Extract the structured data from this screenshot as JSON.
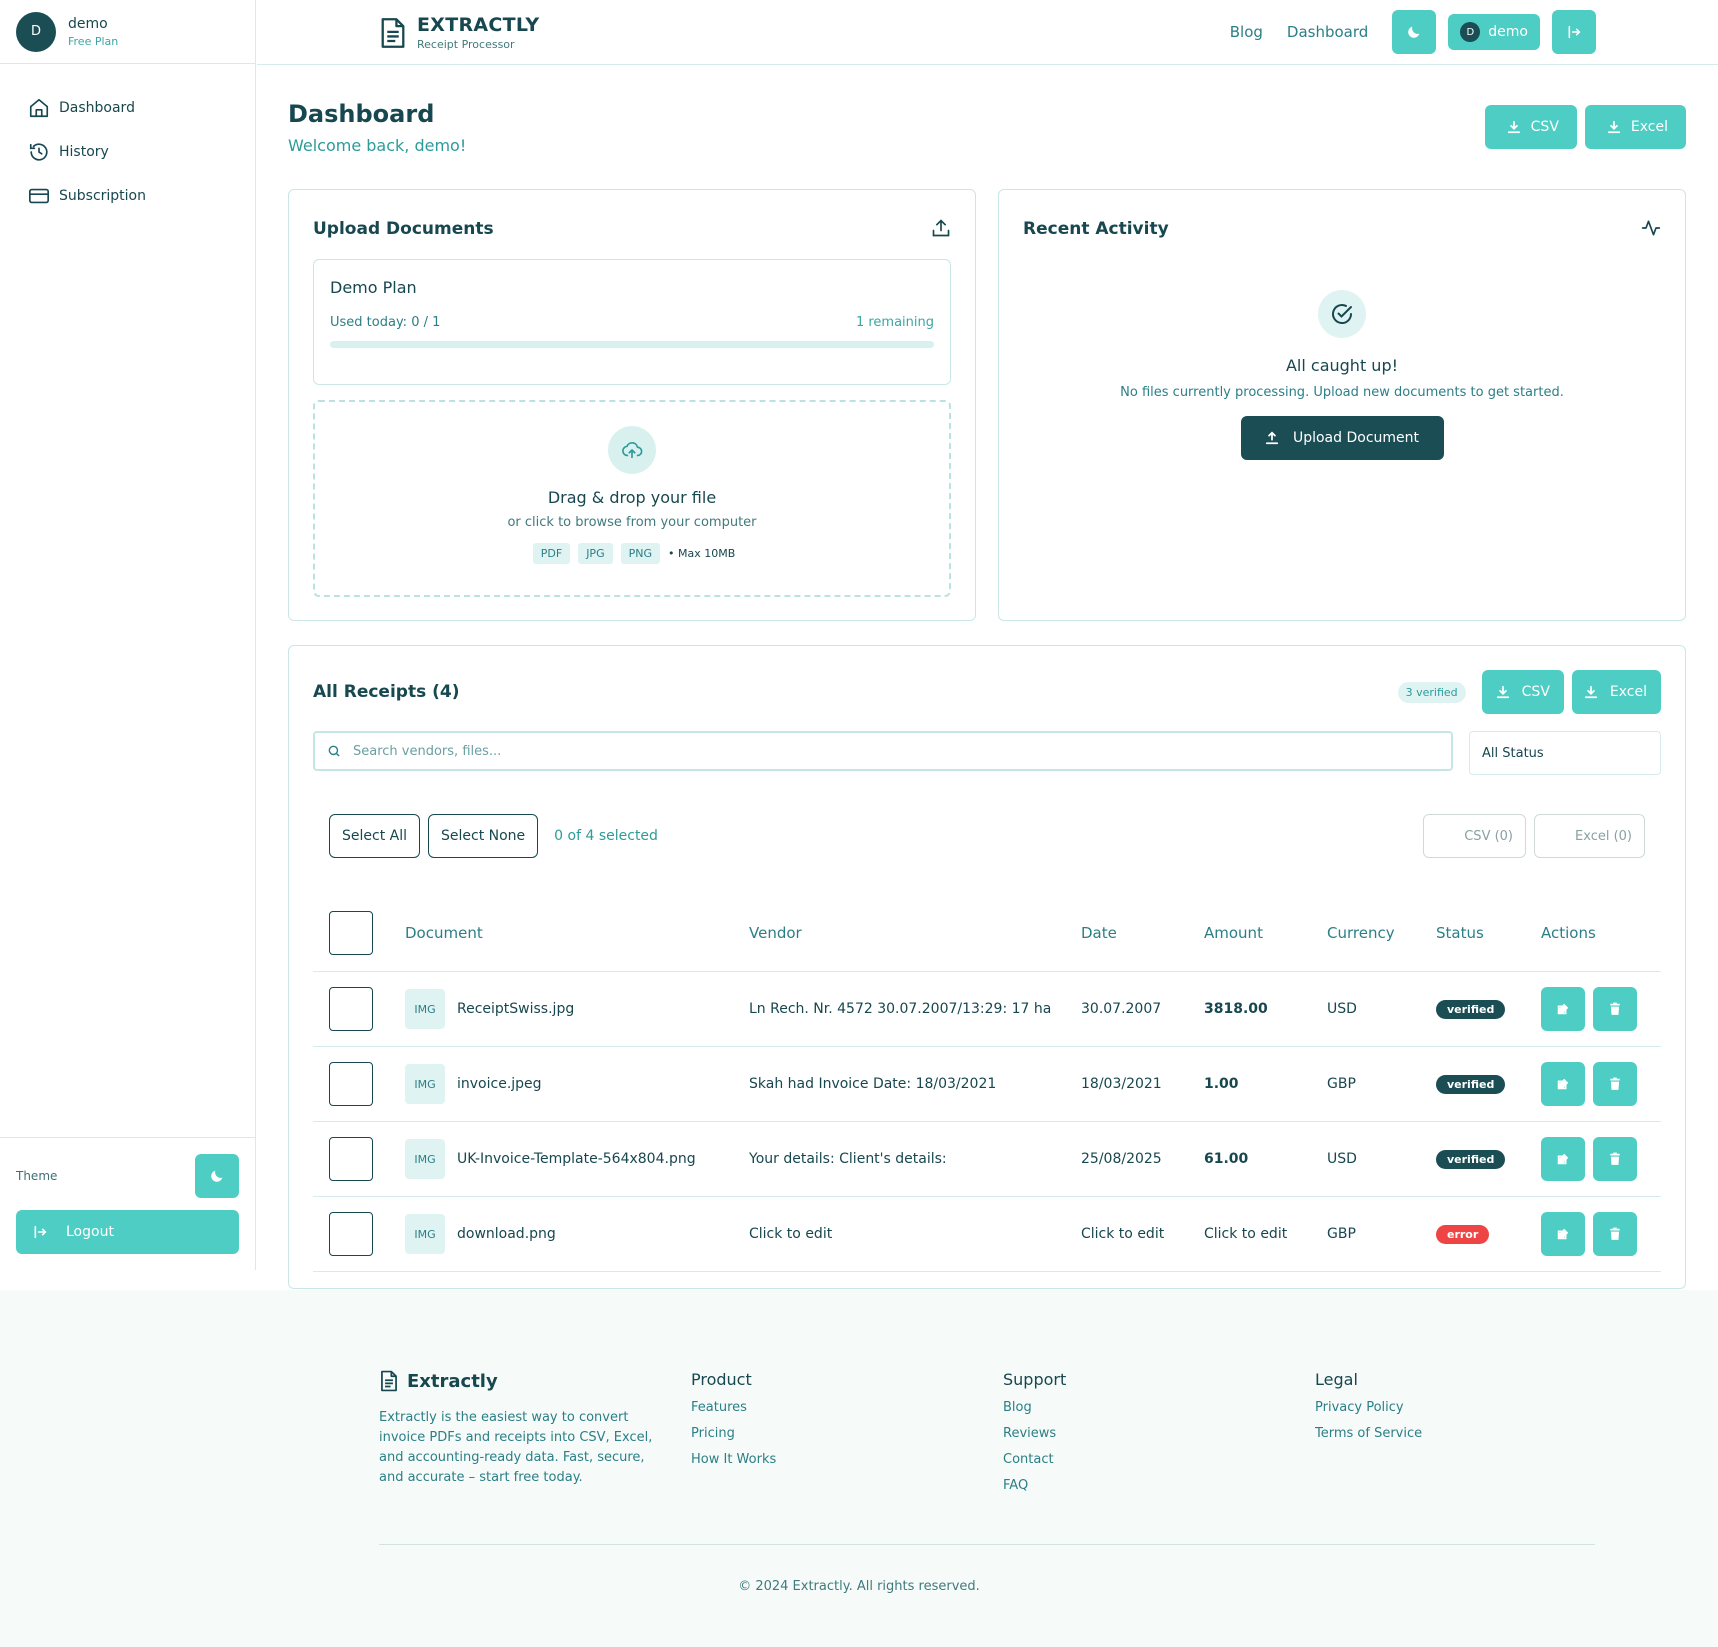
{
  "sidebar": {
    "user": {
      "initial": "D",
      "name": "demo",
      "plan": "Free Plan"
    },
    "items": [
      {
        "label": "Dashboard",
        "icon": "home-icon"
      },
      {
        "label": "History",
        "icon": "history-icon"
      },
      {
        "label": "Subscription",
        "icon": "credit-card-icon"
      }
    ],
    "theme_label": "Theme",
    "logout_label": "Logout"
  },
  "header": {
    "brand_title": "EXTRACTLY",
    "brand_subtitle": "Receipt Processor",
    "links": [
      "Blog",
      "Dashboard"
    ],
    "user_initial": "D",
    "user_name": "demo"
  },
  "main": {
    "title": "Dashboard",
    "welcome": "Welcome back, demo!",
    "export_csv": "CSV",
    "export_excel": "Excel"
  },
  "upload": {
    "title": "Upload Documents",
    "plan_name": "Demo Plan",
    "used_today": "Used today: 0 / 1",
    "remaining": "1 remaining",
    "usage_fraction": 0,
    "drop_title": "Drag & drop your file",
    "drop_sub": "or click to browse from your computer",
    "formats": [
      "PDF",
      "JPG",
      "PNG"
    ],
    "max_size": "• Max 10MB"
  },
  "recent": {
    "title": "Recent Activity",
    "empty_title": "All caught up!",
    "empty_sub": "No files currently processing. Upload new documents to get started.",
    "upload_button": "Upload Document"
  },
  "receipts": {
    "title": "All Receipts (4)",
    "verified_badge": "3 verified",
    "csv_label": "CSV",
    "excel_label": "Excel",
    "search_placeholder": "Search vendors, files...",
    "status_filter": "All Status",
    "select_all": "Select All",
    "select_none": "Select None",
    "selected_count": "0 of 4 selected",
    "csv_selected": "CSV (0)",
    "excel_selected": "Excel (0)",
    "columns": [
      "Document",
      "Vendor",
      "Date",
      "Amount",
      "Currency",
      "Status",
      "Actions"
    ],
    "rows": [
      {
        "type": "IMG",
        "file": "ReceiptSwiss.jpg",
        "vendor": "Ln Rech. Nr. 4572 30.07.2007/13:29: 17 ha",
        "date": "30.07.2007",
        "amount": "3818.00",
        "currency": "USD",
        "status": "verified"
      },
      {
        "type": "IMG",
        "file": "invoice.jpeg",
        "vendor": "Skah had Invoice Date: 18/03/2021",
        "date": "18/03/2021",
        "amount": "1.00",
        "currency": "GBP",
        "status": "verified"
      },
      {
        "type": "IMG",
        "file": "UK-Invoice-Template-564x804.png",
        "vendor": "Your details: Client's details:",
        "date": "25/08/2025",
        "amount": "61.00",
        "currency": "USD",
        "status": "verified"
      },
      {
        "type": "IMG",
        "file": "download.png",
        "vendor": "Click to edit",
        "date": "Click to edit",
        "amount": "Click to edit",
        "currency": "GBP",
        "status": "error"
      }
    ]
  },
  "footer": {
    "brand": "Extractly",
    "description": "Extractly is the easiest way to convert invoice PDFs and receipts into CSV, Excel, and accounting-ready data. Fast, secure, and accurate – start free today.",
    "product": {
      "title": "Product",
      "links": [
        "Features",
        "Pricing",
        "How It Works"
      ]
    },
    "support": {
      "title": "Support",
      "links": [
        "Blog",
        "Reviews",
        "Contact",
        "FAQ"
      ]
    },
    "legal": {
      "title": "Legal",
      "links": [
        "Privacy Policy",
        "Terms of Service"
      ]
    },
    "copyright": "© 2024 Extractly. All rights reserved."
  },
  "colors": {
    "accent": "#4ecdc4",
    "dark": "#1b4d55",
    "verified": "#1b4d55",
    "error": "#ef4444"
  }
}
